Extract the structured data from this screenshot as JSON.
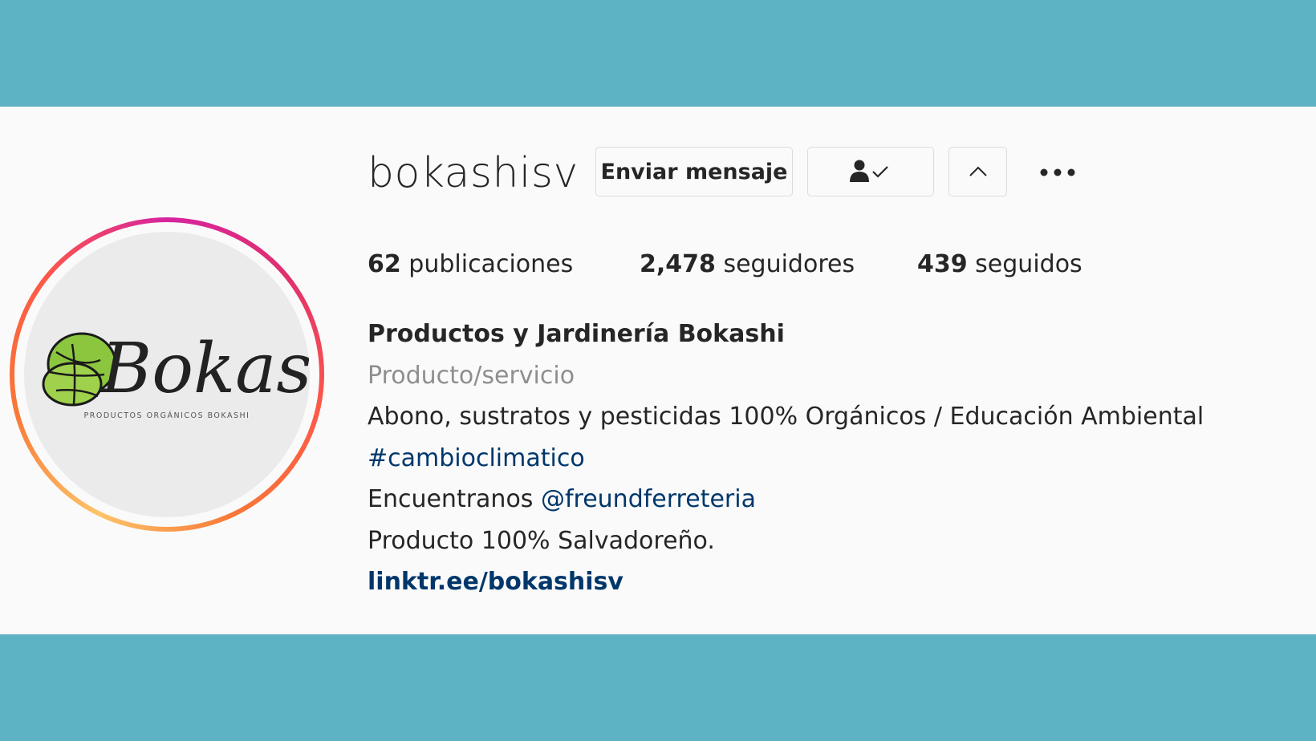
{
  "profile": {
    "username": "bokashisv",
    "buttons": {
      "message_label": "Enviar mensaje"
    },
    "icons": {
      "following": "user-check-icon",
      "suggestions": "chevron-up-icon",
      "options": "more-horizontal-icon"
    },
    "stats": {
      "posts_count": "62",
      "posts_label": "publicaciones",
      "followers_count": "2,478",
      "followers_label": "seguidores",
      "following_count": "439",
      "following_label": "seguidos"
    },
    "full_name": "Productos y Jardinería Bokashi",
    "category": "Producto/servicio",
    "bio_line_1": "Abono, sustratos y pesticidas 100% Orgánicos / Educación Ambiental",
    "hashtag": "#cambioclimatico",
    "find_us_prefix": "Encuentranos ",
    "mention": "@freundferreteria",
    "bio_line_3": "Producto 100% Salvadoreño.",
    "link": "linktr.ee/bokashisv",
    "avatar": {
      "logo_text": "Bokashi",
      "logo_subtitle": "PRODUCTOS ORGÁNICOS BOKASHI"
    }
  },
  "colors": {
    "band": "#5db3c3",
    "panel": "#fafafa",
    "text": "#262626",
    "secondary_text": "#8e8e8e",
    "link": "#00376b",
    "leaf_green": "#8cc63f"
  }
}
